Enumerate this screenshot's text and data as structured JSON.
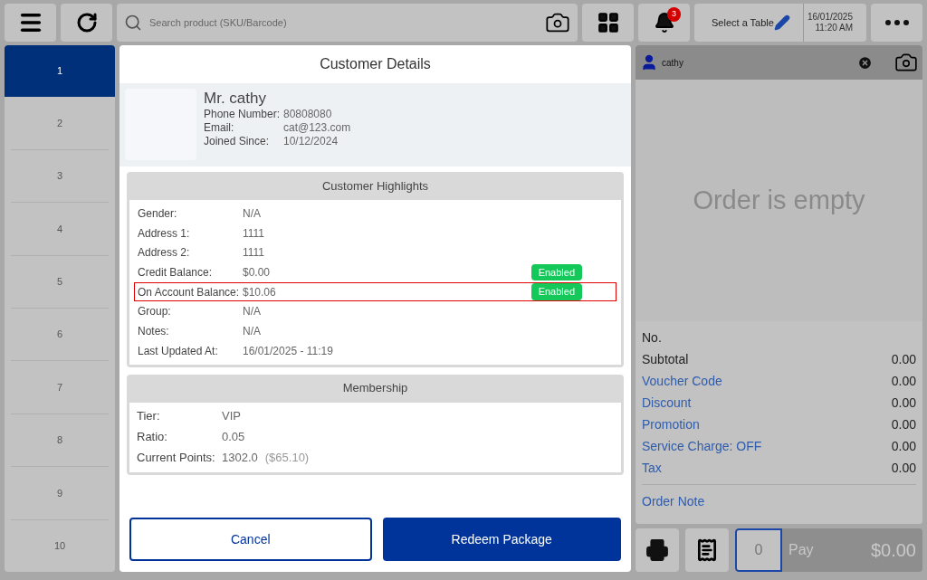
{
  "topbar": {
    "search": {
      "placeholder": "Search product (SKU/Barcode)"
    },
    "notifications": "3",
    "table": "Select a Table",
    "date": "16/01/2025",
    "time": "11:20 AM"
  },
  "pages": [
    {
      "label": "1",
      "selected": true
    },
    {
      "label": "2",
      "selected": false
    },
    {
      "label": "3",
      "selected": false
    },
    {
      "label": "4",
      "selected": false
    },
    {
      "label": "5",
      "selected": false
    },
    {
      "label": "6",
      "selected": false
    },
    {
      "label": "7",
      "selected": false
    },
    {
      "label": "8",
      "selected": false
    },
    {
      "label": "9",
      "selected": false
    },
    {
      "label": "10",
      "selected": false
    }
  ],
  "dialog": {
    "title": "Customer Details",
    "name": "Mr. cathy",
    "contact": [
      {
        "label": "Phone Number:",
        "value": "80808080"
      },
      {
        "label": "Email:",
        "value": "cat@123.com"
      },
      {
        "label": "Joined Since:",
        "value": "10/12/2024"
      }
    ],
    "highlights": {
      "title": "Customer Highlights",
      "rows": [
        {
          "label": "Gender:",
          "value": "N/A",
          "highlighted": false
        },
        {
          "label": "Address 1:",
          "value": "1111",
          "highlighted": false
        },
        {
          "label": "Address 2:",
          "value": "1111",
          "highlighted": false
        },
        {
          "label": "Credit Balance:",
          "value": "$0.00",
          "badge": "Enabled",
          "highlighted": false
        },
        {
          "label": "On Account Balance:",
          "value": "$10.06",
          "badge": "Enabled",
          "highlighted": true
        },
        {
          "label": "Group:",
          "value": "N/A",
          "highlighted": false
        },
        {
          "label": "Notes:",
          "value": "N/A",
          "highlighted": false
        },
        {
          "label": "Last Updated At:",
          "value": "16/01/2025 - 11:19",
          "highlighted": false
        }
      ]
    },
    "membership": {
      "title": "Membership",
      "rows": [
        {
          "label": "Tier:",
          "value": "VIP"
        },
        {
          "label": "Ratio:",
          "value": "0.05"
        },
        {
          "label": "Current Points:",
          "value": "1302.0",
          "note": "($65.10)"
        }
      ]
    },
    "buttons": [
      {
        "kind": "secondary",
        "label": "Cancel"
      },
      {
        "kind": "primary",
        "label": "Redeem Package"
      }
    ]
  },
  "order": {
    "customer": "cathy",
    "empty_message": "Order is empty",
    "number_label": "No.",
    "totals": [
      {
        "label": "Subtotal",
        "value": "0.00",
        "kind": "plain"
      },
      {
        "label": "Voucher Code",
        "value": "0.00",
        "kind": "link"
      },
      {
        "label": "Discount",
        "value": "0.00",
        "kind": "link"
      },
      {
        "label": "Promotion",
        "value": "0.00",
        "kind": "link"
      },
      {
        "label": "Service Charge: OFF",
        "value": "0.00",
        "kind": "link"
      },
      {
        "label": "Tax",
        "value": "0.00",
        "kind": "link"
      }
    ],
    "note_link": "Order Note",
    "quantity": "0",
    "pay_label": "Pay",
    "pay_amount": "$0.00"
  }
}
